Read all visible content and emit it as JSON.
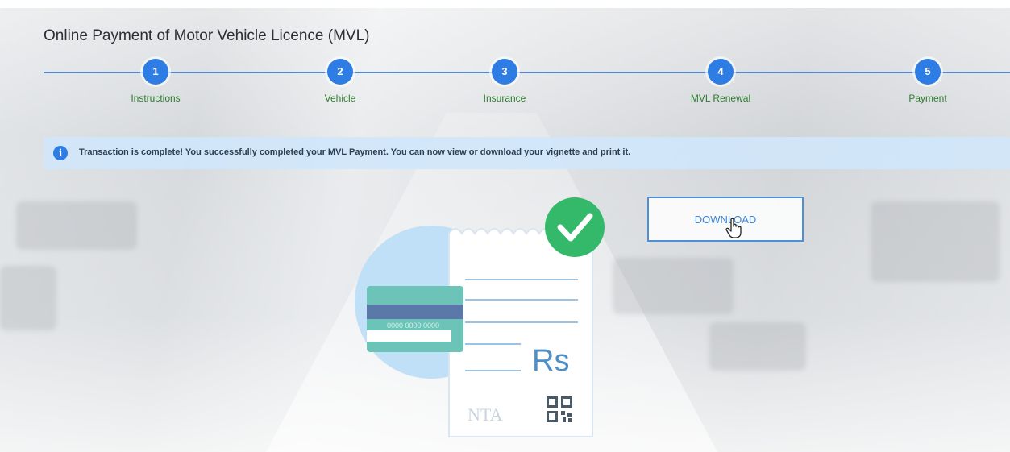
{
  "page": {
    "title": "Online Payment of Motor Vehicle Licence (MVL)"
  },
  "steps": [
    {
      "number": "1",
      "label": "Instructions"
    },
    {
      "number": "2",
      "label": "Vehicle"
    },
    {
      "number": "3",
      "label": "Insurance"
    },
    {
      "number": "4",
      "label": "MVL Renewal"
    },
    {
      "number": "5",
      "label": "Payment"
    }
  ],
  "alert": {
    "icon": "info-icon",
    "message": "Transaction is complete! You successfully completed your MVL Payment. You can now view or download your vignette and print it."
  },
  "download": {
    "label": "DOWNLOAD"
  },
  "illustration": {
    "card_number": "0000 0000 0000",
    "currency": "Rs",
    "logo_text": "NTA",
    "colors": {
      "circle": "#bfe0f7",
      "check": "#34b96a",
      "card": "#6cc3b8",
      "card_stripe": "#5a79a8"
    }
  },
  "colors": {
    "accent": "#2e7de5",
    "step_label": "#2e7d2e",
    "alert_bg": "#d0e6fa"
  }
}
